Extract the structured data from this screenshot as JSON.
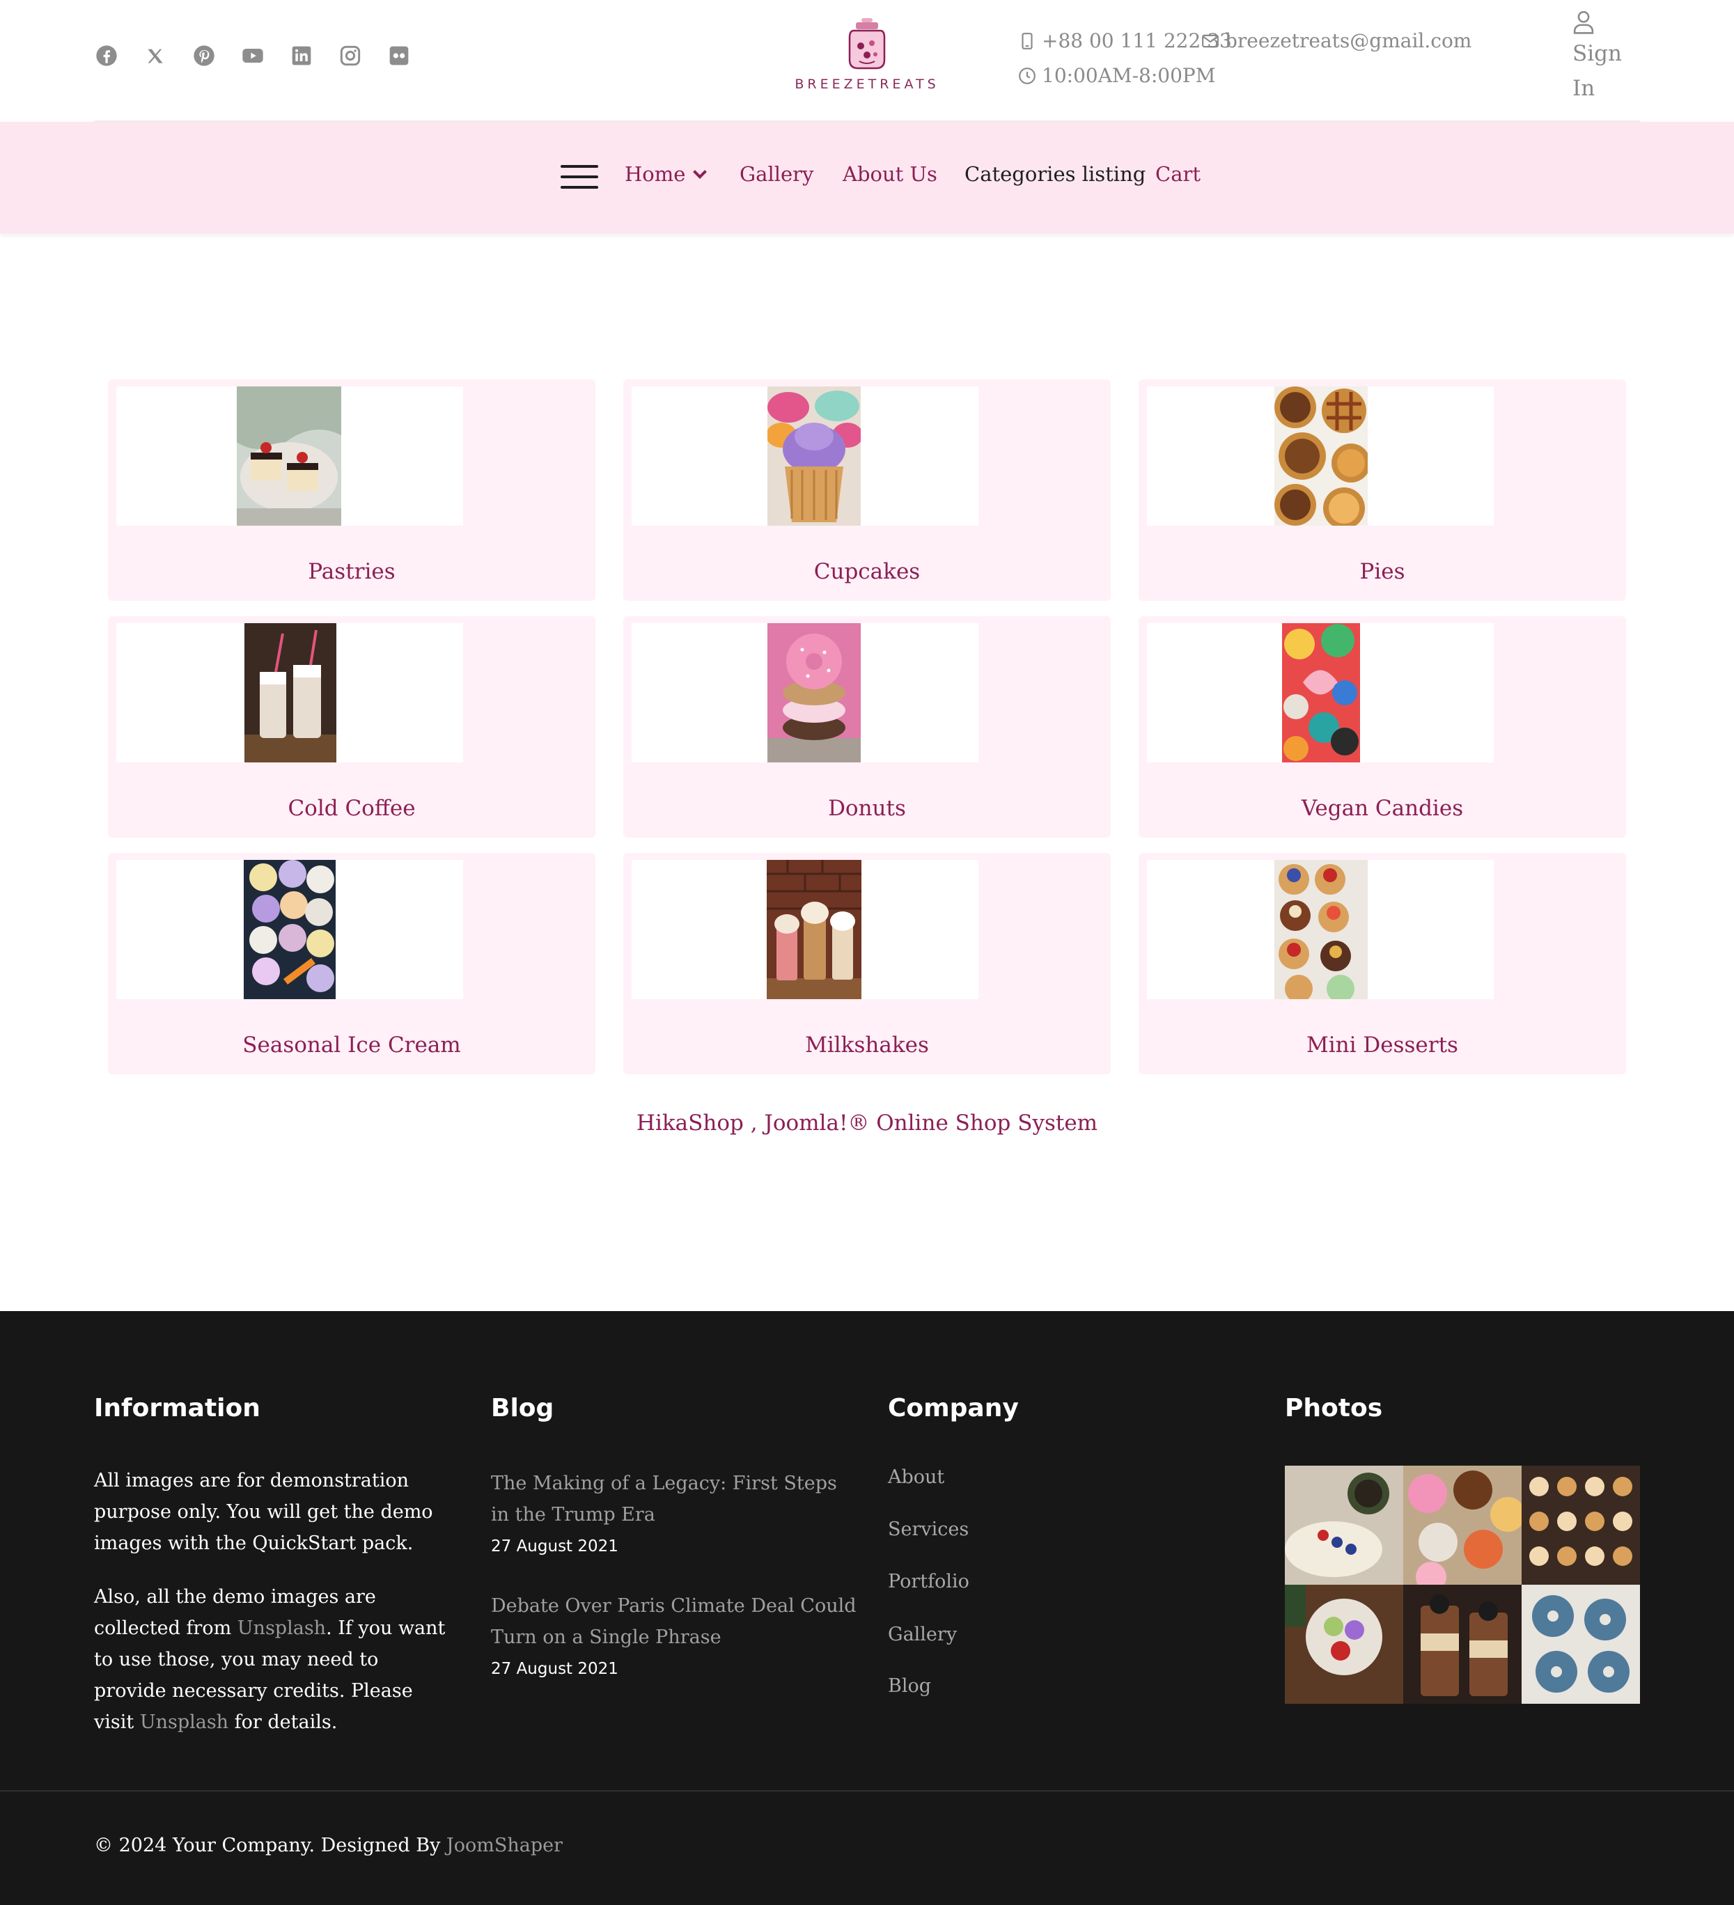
{
  "header": {
    "social_icons": [
      "facebook-icon",
      "x-twitter-icon",
      "pinterest-icon",
      "youtube-icon",
      "linkedin-icon",
      "instagram-icon",
      "flickr-icon"
    ],
    "logo_text": "BREEZETREATS",
    "phone": "+88 00 111 222 33",
    "email": "breezetreats@gmail.com",
    "hours": "10:00AM-8:00PM",
    "signin_line1": "Sign",
    "signin_line2": "In"
  },
  "nav": {
    "home": "Home",
    "gallery": "Gallery",
    "about": "About Us",
    "categories": "Categories listing",
    "cart": "Cart"
  },
  "categories": [
    {
      "label": "Pastries"
    },
    {
      "label": "Cupcakes"
    },
    {
      "label": "Pies"
    },
    {
      "label": "Cold Coffee"
    },
    {
      "label": "Donuts"
    },
    {
      "label": "Vegan Candies"
    },
    {
      "label": "Seasonal Ice Cream"
    },
    {
      "label": "Milkshakes"
    },
    {
      "label": "Mini Desserts"
    }
  ],
  "hikashop_link": "HikaShop , Joomla!® Online Shop System",
  "footer": {
    "information": {
      "title": "Information",
      "p1": "All images are for demonstration purpose only. You will get the demo images with the QuickStart pack.",
      "p2_a": "Also, all the demo images are collected from ",
      "p2_link1": "Unsplash",
      "p2_b": ". If you want to use those, you may need to provide necessary credits. Please visit ",
      "p2_link2": "Unsplash",
      "p2_c": " for details."
    },
    "blog": {
      "title": "Blog",
      "posts": [
        {
          "title": "The Making of a Legacy: First Steps in the Trump Era",
          "date": "27 August 2021"
        },
        {
          "title": "Debate Over Paris Climate Deal Could Turn on a Single Phrase",
          "date": "27 August 2021"
        }
      ]
    },
    "company": {
      "title": "Company",
      "links": [
        "About",
        "Services",
        "Portfolio",
        "Gallery",
        "Blog"
      ]
    },
    "photos": {
      "title": "Photos"
    },
    "copyright_prefix": "© 2024 Your Company. Designed By ",
    "copyright_link": "JoomShaper"
  },
  "colors": {
    "accent": "#8c1f55",
    "nav_bg": "#fde6f0",
    "card_bg": "#fff1f7",
    "footer_bg": "#171717"
  }
}
